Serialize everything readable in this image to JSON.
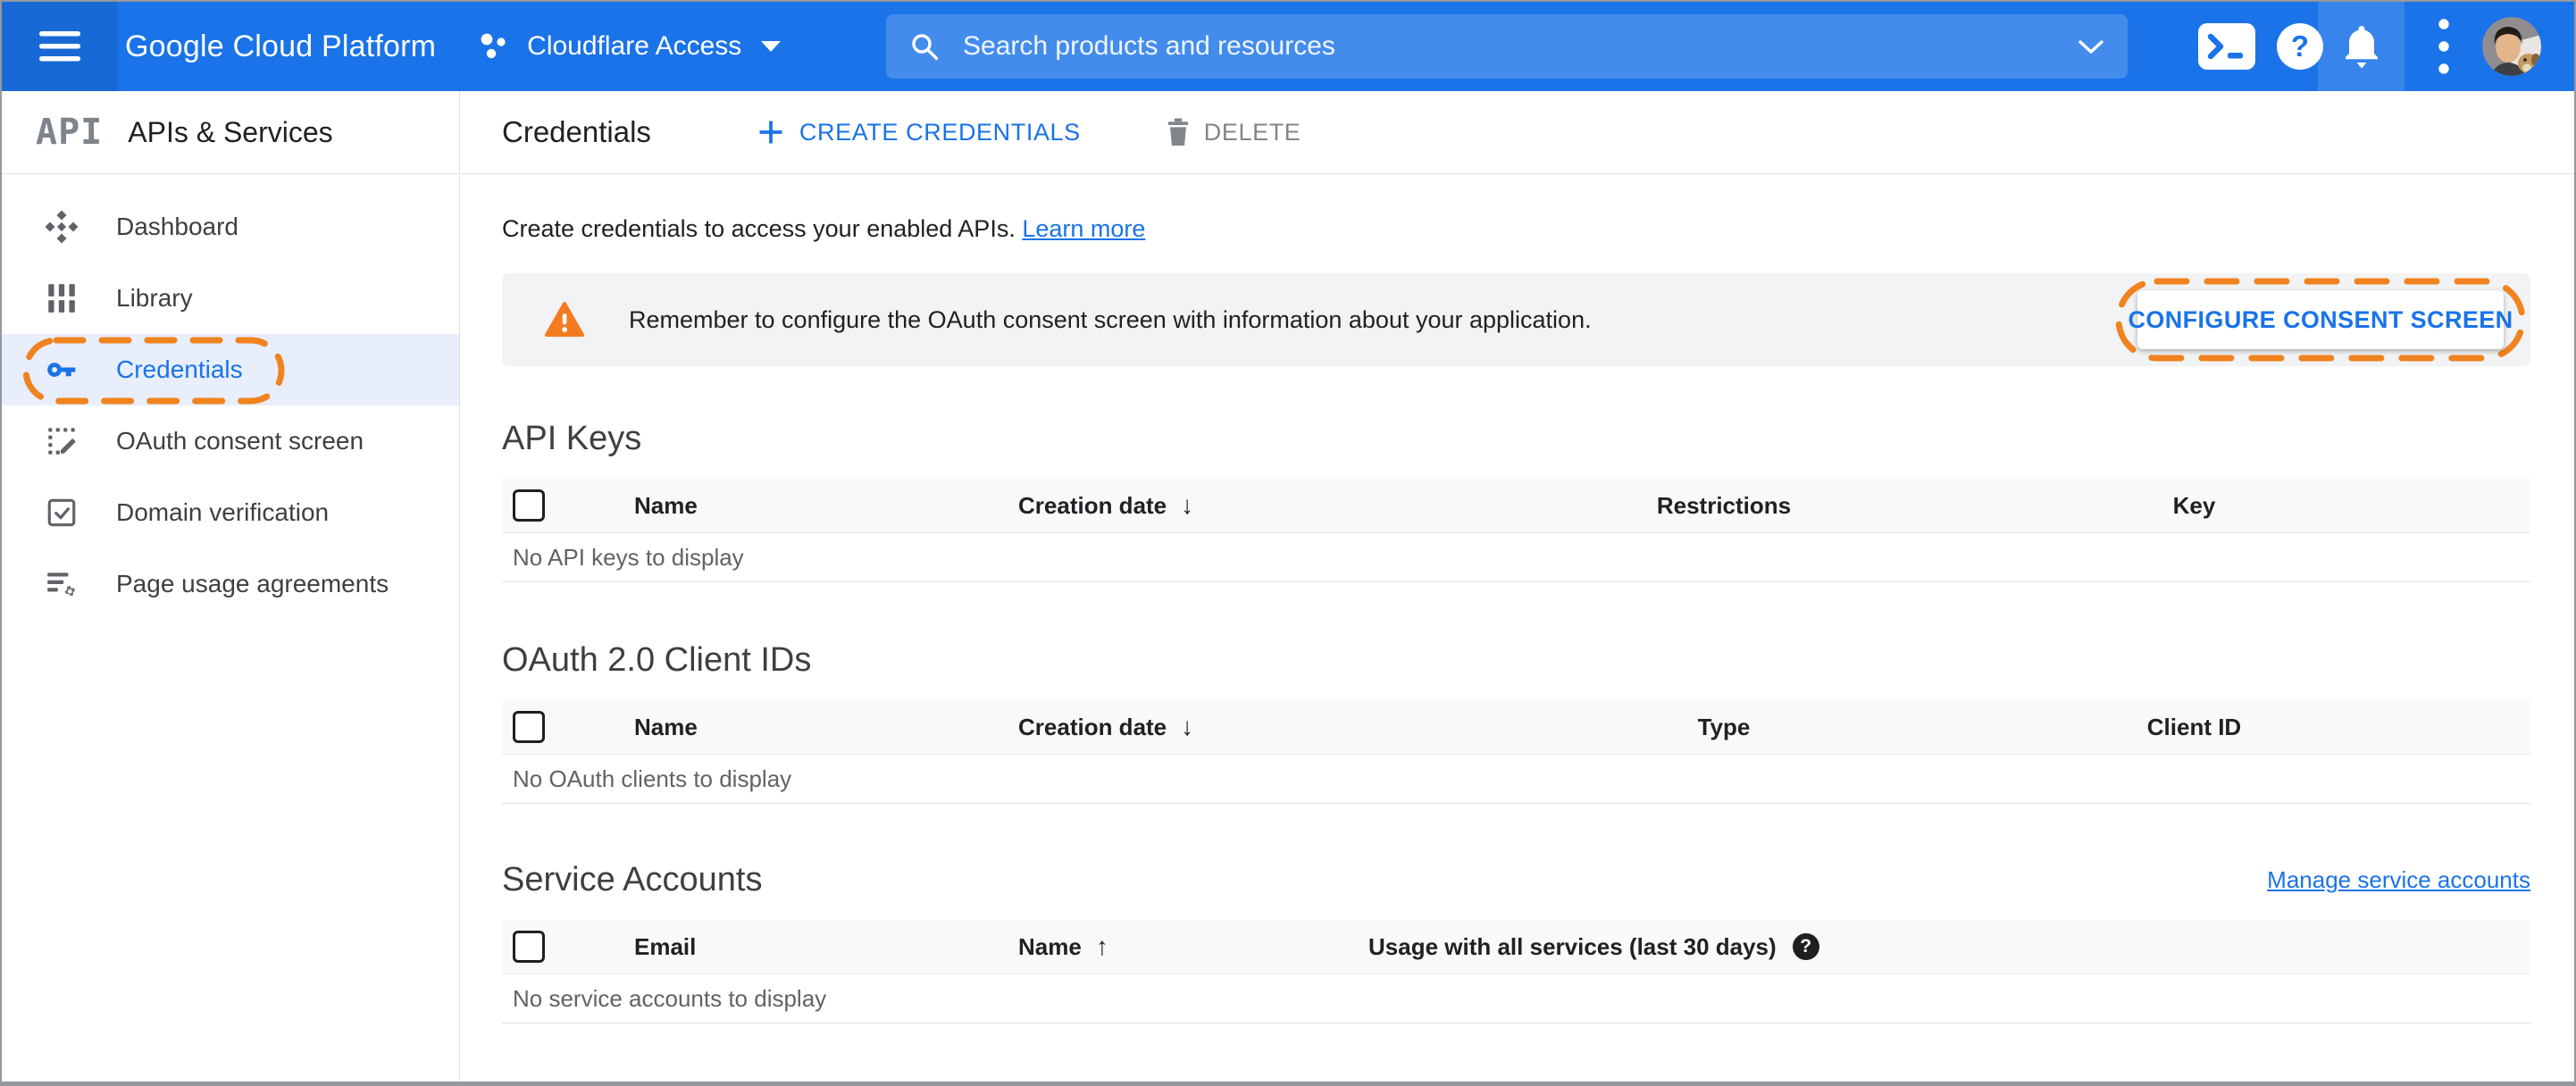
{
  "colors": {
    "topbar_blue": "#1a73e8",
    "accent_blue": "#1a73e8",
    "annotation_orange": "#f0831f",
    "warning_orange": "#f47b20",
    "banner_gray": "#f1f3f4",
    "selected_row_bg": "#e8eefb"
  },
  "topbar": {
    "logo": "Google Cloud Platform",
    "project_name": "Cloudflare Access",
    "search_placeholder": "Search products and resources",
    "icon_names": [
      "menu-icon",
      "project-icon",
      "search-icon",
      "chevron-down-icon",
      "cloud-shell-icon",
      "help-icon",
      "notifications-icon",
      "more-vert-icon",
      "avatar"
    ]
  },
  "sidebar": {
    "logo": "API",
    "title": "APIs & Services",
    "items": [
      {
        "label": "Dashboard",
        "icon": "dashboard-icon",
        "selected": false
      },
      {
        "label": "Library",
        "icon": "library-icon",
        "selected": false
      },
      {
        "label": "Credentials",
        "icon": "key-icon",
        "selected": true,
        "annotated": true
      },
      {
        "label": "OAuth consent screen",
        "icon": "consent-screen-icon",
        "selected": false
      },
      {
        "label": "Domain verification",
        "icon": "domain-verification-icon",
        "selected": false
      },
      {
        "label": "Page usage agreements",
        "icon": "agreements-icon",
        "selected": false
      }
    ]
  },
  "header": {
    "title": "Credentials",
    "create_button": "CREATE CREDENTIALS",
    "delete_button": "DELETE"
  },
  "intro": {
    "text": "Create credentials to access your enabled APIs. ",
    "link": "Learn more"
  },
  "banner": {
    "text": "Remember to configure the OAuth consent screen with information about your application.",
    "button": "CONFIGURE CONSENT SCREEN"
  },
  "api_keys": {
    "title": "API Keys",
    "columns": [
      "Name",
      "Creation date",
      "Restrictions",
      "Key"
    ],
    "sort": {
      "column": "Creation date",
      "direction": "desc",
      "arrow": "↓"
    },
    "empty": "No API keys to display"
  },
  "oauth": {
    "title": "OAuth 2.0 Client IDs",
    "columns": [
      "Name",
      "Creation date",
      "Type",
      "Client ID"
    ],
    "sort": {
      "column": "Creation date",
      "direction": "desc",
      "arrow": "↓"
    },
    "empty": "No OAuth clients to display"
  },
  "service_accounts": {
    "title": "Service Accounts",
    "link": "Manage service accounts",
    "columns": [
      "Email",
      "Name",
      "Usage with all services (last 30 days)"
    ],
    "sort": {
      "column": "Name",
      "direction": "asc",
      "arrow": "↑"
    },
    "empty": "No service accounts to display"
  }
}
